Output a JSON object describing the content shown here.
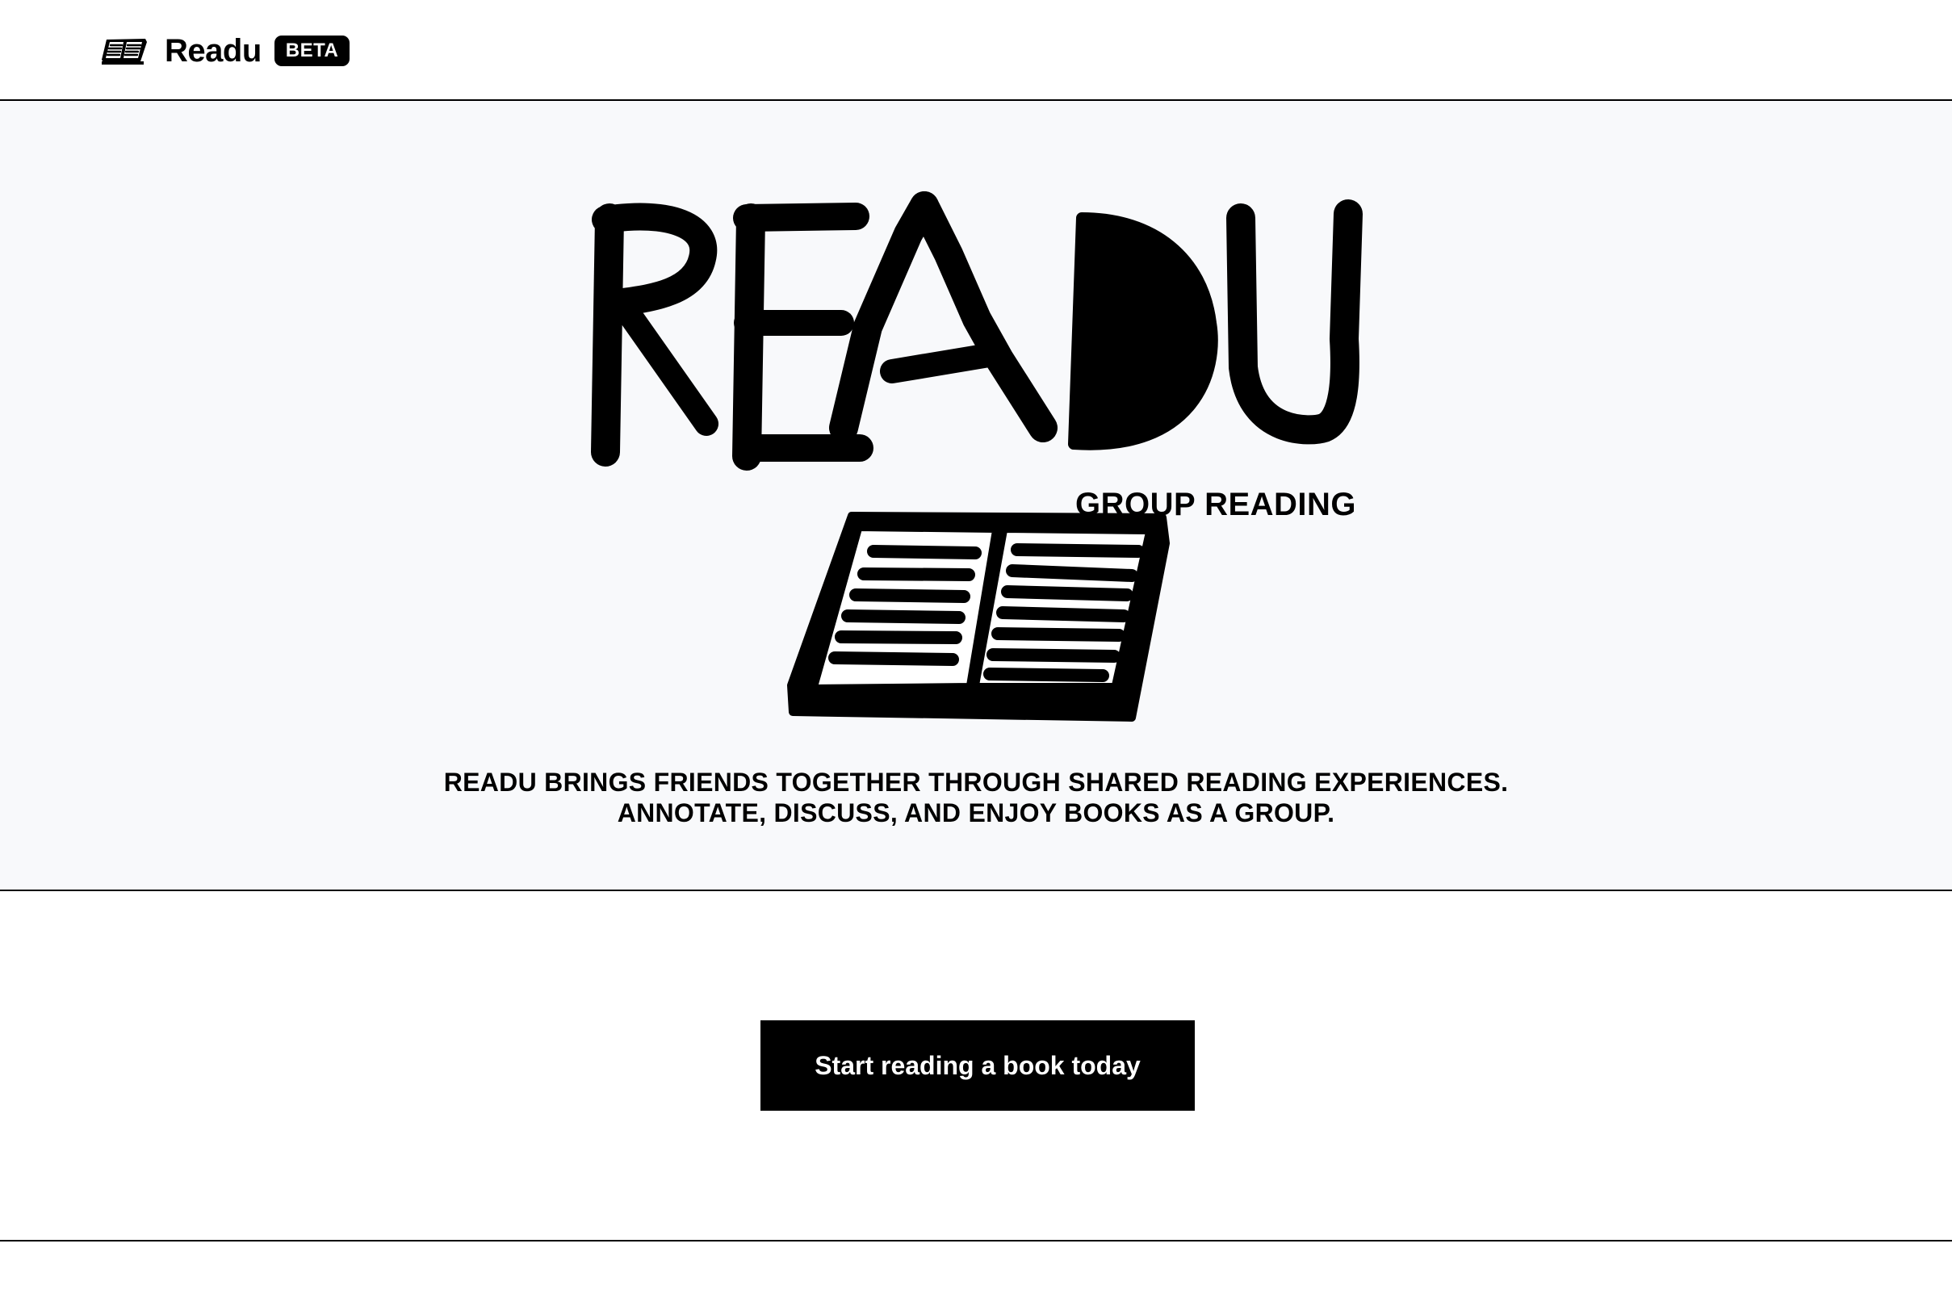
{
  "header": {
    "brand_name": "Readu",
    "badge": "BETA",
    "logo_icon": "open-book-icon"
  },
  "hero": {
    "title": "READU",
    "subtitle": "GROUP READING",
    "illustration_icon": "open-book-illustration",
    "tagline_line1": "READU BRINGS FRIENDS TOGETHER THROUGH SHARED READING EXPERIENCES.",
    "tagline_line2": "ANNOTATE, DISCUSS, AND ENJOY BOOKS AS A GROUP.",
    "background_color": "#f8f9fb"
  },
  "cta": {
    "label": "Start reading a book today",
    "background_color": "#000000",
    "text_color": "#ffffff"
  }
}
